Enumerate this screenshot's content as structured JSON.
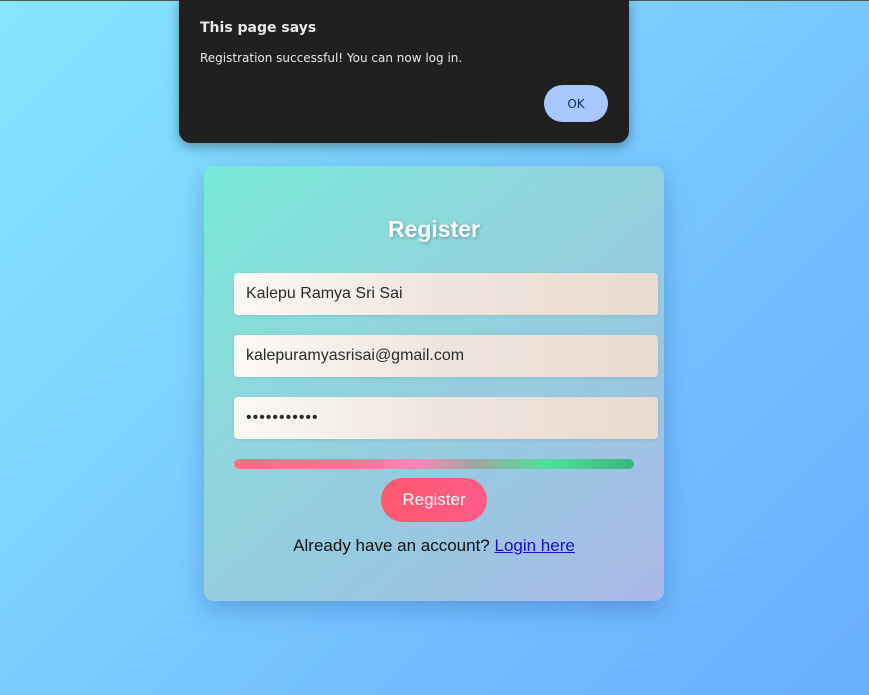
{
  "dialog": {
    "title": "This page says",
    "message": "Registration successful! You can now log in.",
    "ok_label": "OK"
  },
  "form": {
    "title": "Register",
    "name_value": "Kalepu Ramya Sri Sai",
    "email_value": "kalepuramyasrisai@gmail.com",
    "password_value": "•••••••••••",
    "register_label": "Register",
    "login_prompt": "Already have an account?",
    "login_link": "Login here"
  },
  "colors": {
    "dialog_bg": "#202020",
    "ok_button": "#a8c7fa",
    "register_button": "#ff5a7a",
    "link": "#1a0dcc"
  }
}
